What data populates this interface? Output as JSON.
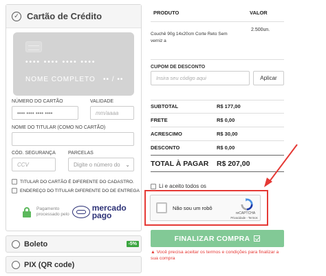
{
  "payment": {
    "credit_card": {
      "title": "Cartão de Crédito",
      "card_preview": {
        "number_mask": "•••• •••• •••• ••••",
        "name": "NOME COMPLETO",
        "expiry": "•• / ••"
      },
      "number_label": "NÚMERO DO CARTÃO",
      "number_value": "•••• •••• •••• ••••",
      "expiry_label": "VALIDADE",
      "expiry_placeholder": "mm/aaaa",
      "holder_label": "NOME DO TITULAR (COMO NO CARTÃO)",
      "cvv_label": "CÓD. SEGURANÇA",
      "cvv_placeholder": "CCV",
      "installments_label": "PARCELAS",
      "installments_value": "Digite o número do",
      "checkbox_holder": "TITULAR DO CARTÃO É DIFERENTE DO CADASTRO.",
      "checkbox_address": "ENDEREÇO DO TITULAR DIFERENTE DO DE ENTREGA",
      "processed_line1": "Pagamento",
      "processed_line2": "processado pelo",
      "brand_line1": "mercado",
      "brand_line2": "pago"
    },
    "boleto": {
      "title": "Boleto",
      "badge": "-5%"
    },
    "pix": {
      "title": "PIX (QR code)"
    }
  },
  "order": {
    "col_product": "PRODUTO",
    "col_value": "VALOR",
    "product_name": "Couchê 90g 14x20cm Corte Reto Sem verniz a",
    "product_qty": "2.500un.",
    "coupon_label": "CUPOM DE DESCONTO",
    "coupon_placeholder": "Insira seu código aqui",
    "apply_label": "Aplicar",
    "summary": [
      {
        "label": "SUBTOTAL",
        "value": "R$ 177,00"
      },
      {
        "label": "FRETE",
        "value": "R$ 0,00"
      },
      {
        "label": "ACRESCIMO",
        "value": "R$ 30,00"
      },
      {
        "label": "DESCONTO",
        "value": "R$ 0,00"
      }
    ],
    "total_label": "TOTAL À PAGAR",
    "total_value": "R$ 207,00",
    "terms_label": "Li e aceito todos os",
    "recaptcha": {
      "label": "Não sou um robô",
      "brand": "reCAPTCHA",
      "links": "Privacidade - Termos"
    },
    "finish_label": "FINALIZAR COMPRA",
    "warning": "Você precisa aceitar os termos e condições para finalizar a sua compra"
  },
  "colors": {
    "accent_green": "#82c996",
    "badge_green": "#3aa53f",
    "warning_red": "#e53935",
    "mercado_pago_blue": "#2d3277"
  }
}
